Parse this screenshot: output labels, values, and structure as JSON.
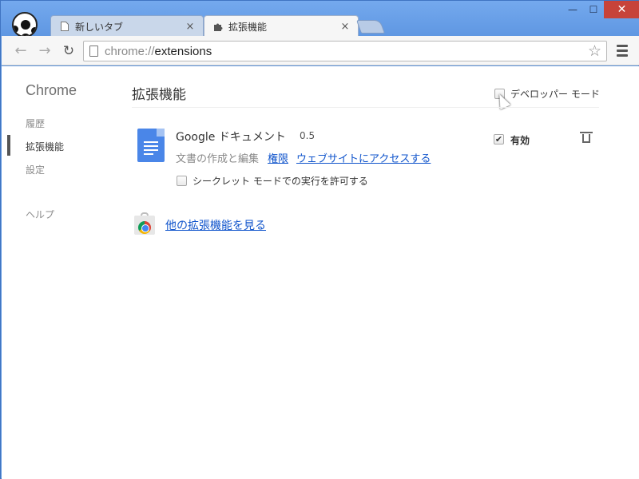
{
  "tabs": [
    {
      "title": "新しいタブ",
      "close": "×"
    },
    {
      "title": "拡張機能",
      "close": "×"
    }
  ],
  "window_controls": {
    "minimize": "—",
    "maximize": "☐",
    "close": "✕"
  },
  "toolbar": {
    "back": "←",
    "forward": "→",
    "reload": "↻",
    "url_scheme": "chrome://",
    "url_path": "extensions",
    "star": "☆"
  },
  "sidebar": {
    "title": "Chrome",
    "items": [
      {
        "label": "履歴"
      },
      {
        "label": "拡張機能"
      },
      {
        "label": "設定"
      },
      {
        "label": "ヘルプ"
      }
    ]
  },
  "main": {
    "title": "拡張機能",
    "developer_mode_label": "デベロッパー モード",
    "developer_mode_checked": false,
    "extension": {
      "name": "Google ドキュメント",
      "version": "0.5",
      "description": "文書の作成と編集",
      "permissions_link": "権限",
      "website_link": "ウェブサイトにアクセスする",
      "incognito_label": "シークレット モードでの実行を許可する",
      "incognito_checked": false,
      "enabled_label": "有効",
      "enabled_checked": true,
      "enabled_mark": "✔"
    },
    "more_extensions_link": "他の拡張機能を見る"
  },
  "colors": {
    "link": "#1155cc",
    "frame": "#5b93dd",
    "docs_blue": "#4a86e8",
    "close_button": "#c7433a"
  },
  "icons": [
    "profile-avatar-icon",
    "page-icon",
    "puzzle-icon",
    "star-icon",
    "menu-icon",
    "docs-icon",
    "trash-icon",
    "web-store-icon"
  ]
}
